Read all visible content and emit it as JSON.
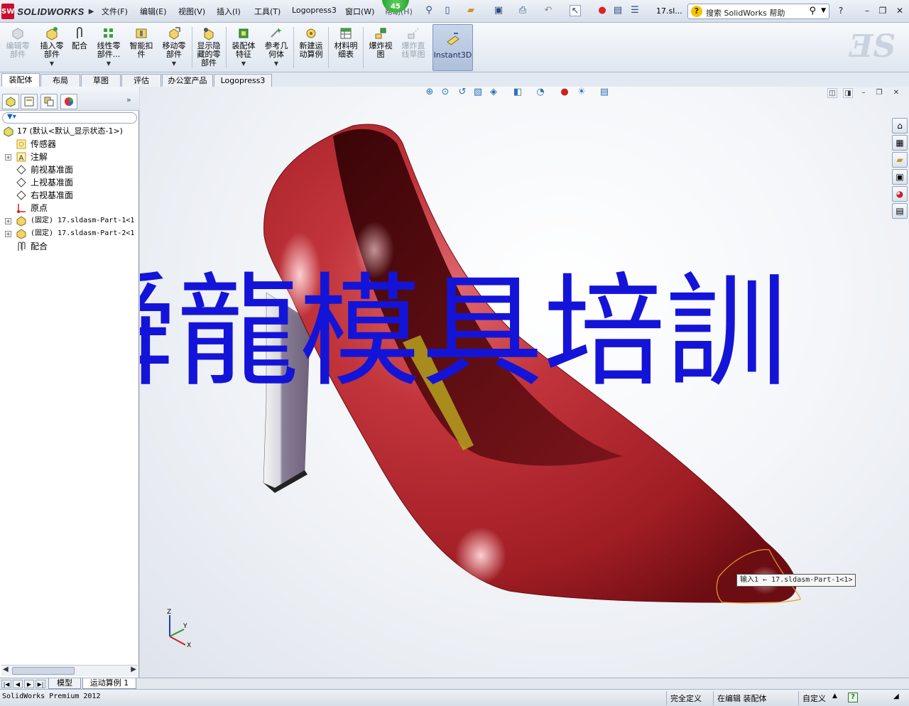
{
  "titlebar": {
    "logo_text": "SOLIDWORKS",
    "logo_mark": "SW",
    "menus": [
      "文件(F)",
      "编辑(E)",
      "视图(V)",
      "插入(I)",
      "工具(T)",
      "Logopress3",
      "窗口(W)",
      "帮助(H)"
    ],
    "badge": "45",
    "filename": "17.sl...",
    "search_placeholder": "搜索 SolidWorks 帮助",
    "help_mark": "?"
  },
  "ribbon": {
    "buttons": [
      {
        "label": "编辑零\n部件",
        "disabled": true
      },
      {
        "label": "插入零\n部件",
        "disabled": false
      },
      {
        "label": "配合",
        "disabled": false
      },
      {
        "label": "线性零\n部件...",
        "disabled": false
      },
      {
        "label": "智能扣\n件",
        "disabled": false
      },
      {
        "label": "移动零\n部件",
        "disabled": false
      },
      {
        "label": "显示隐\n藏的零\n部件",
        "disabled": false
      },
      {
        "label": "装配体\n特征",
        "disabled": false
      },
      {
        "label": "参考几\n何体",
        "disabled": false
      },
      {
        "label": "新建运\n动算例",
        "disabled": false
      },
      {
        "label": "材料明\n细表",
        "disabled": false
      },
      {
        "label": "爆炸视\n图",
        "disabled": false
      },
      {
        "label": "爆炸直\n线草图",
        "disabled": true
      }
    ],
    "instant3d": "Instant3D"
  },
  "tabs": [
    "装配体",
    "布局",
    "草图",
    "评估",
    "办公室产品",
    "Logopress3"
  ],
  "tree": {
    "root": "17  (默认<默认_显示状态-1>)",
    "items": [
      "传感器",
      "注解",
      "前视基准面",
      "上视基准面",
      "右视基准面",
      "原点",
      "(固定) 17.sldasm-Part-1<1",
      "(固定) 17.sldasm-Part-2<1",
      "配合"
    ]
  },
  "viewport": {
    "watermark": "舜龍模具培訓",
    "callout": "输入1 ← 17.sldasm-Part-1<1>",
    "triad": {
      "z": "Z",
      "y": "Y",
      "x": "X"
    },
    "colors": {
      "shoe": "#b3262e",
      "heel": "#8b7e98",
      "watermark": "#1414d8"
    }
  },
  "bottom_tabs": [
    "模型",
    "运动算例 1"
  ],
  "status": {
    "product": "SolidWorks Premium 2012",
    "definition": "完全定义",
    "mode": "在编辑 装配体",
    "custom": "自定义"
  }
}
